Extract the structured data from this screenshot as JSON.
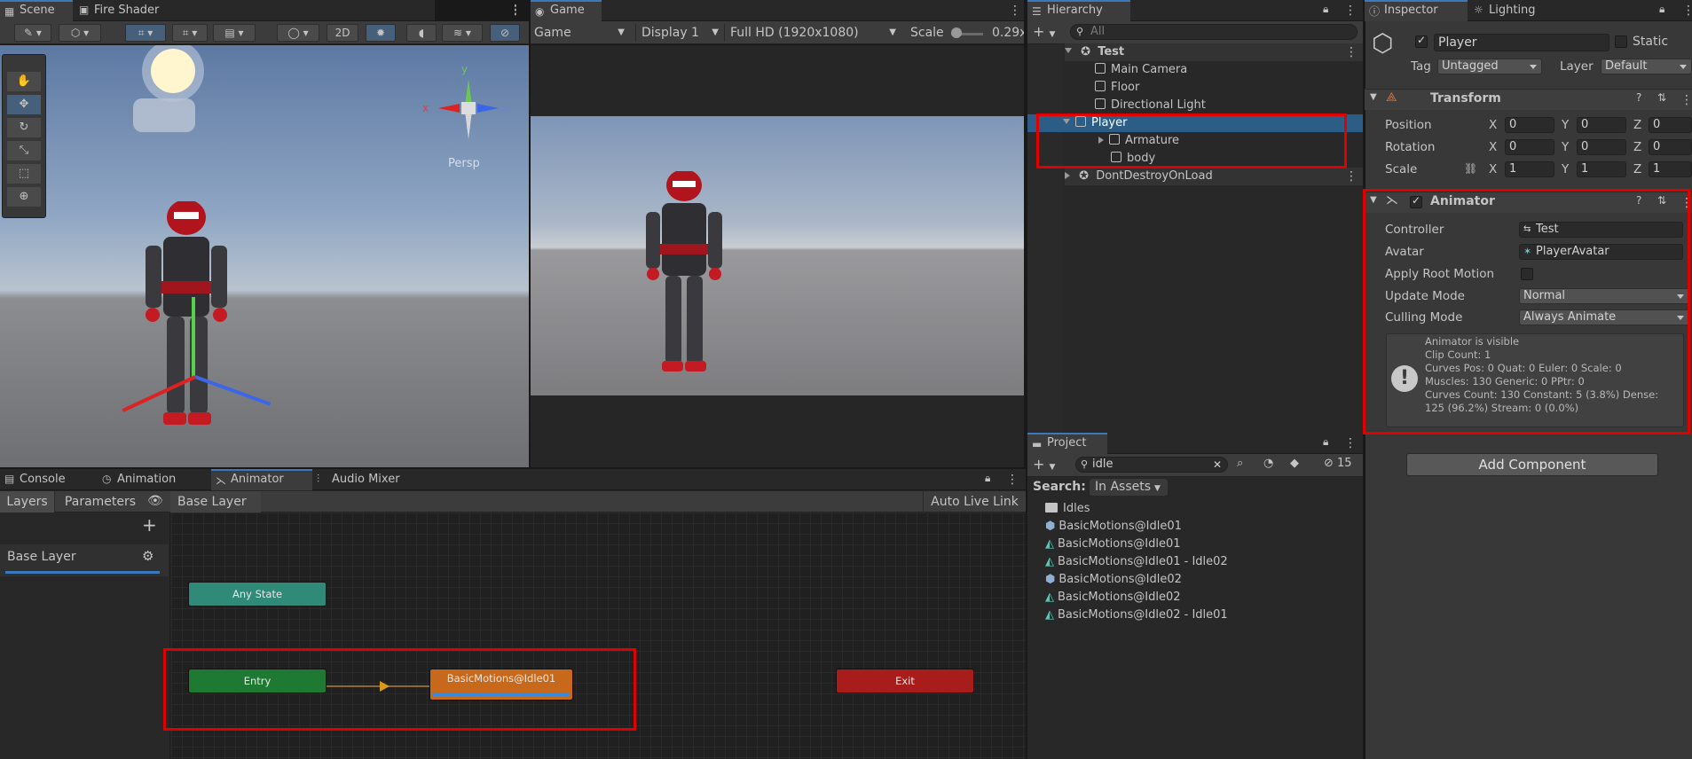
{
  "scene_tabs": {
    "scene": "Scene",
    "fire_shader": "Fire Shader"
  },
  "scene_toolbar": {
    "btn_2d": "2D",
    "persp": "Persp",
    "gizmo_x": "x",
    "gizmo_y": "y",
    "gizmo_z": "z"
  },
  "game": {
    "tab": "Game",
    "view_dropdown": "Game",
    "display_dropdown": "Display 1",
    "resolution_dropdown": "Full HD (1920x1080)",
    "scale_label": "Scale",
    "scale_value": "0.29x"
  },
  "hierarchy": {
    "tab": "Hierarchy",
    "search_placeholder": "All",
    "items": {
      "test": "Test",
      "main_camera": "Main Camera",
      "floor": "Floor",
      "directional_light": "Directional Light",
      "player": "Player",
      "armature": "Armature",
      "body": "body",
      "dont_destroy": "DontDestroyOnLoad"
    }
  },
  "inspector": {
    "tab": "Inspector",
    "lighting_tab": "Lighting",
    "object_name": "Player",
    "static_label": "Static",
    "tag_label": "Tag",
    "tag_value": "Untagged",
    "layer_label": "Layer",
    "layer_value": "Default",
    "transform": {
      "title": "Transform",
      "position_label": "Position",
      "rotation_label": "Rotation",
      "scale_label": "Scale",
      "x": "X",
      "y": "Y",
      "z": "Z",
      "position": [
        "0",
        "0",
        "0"
      ],
      "rotation": [
        "0",
        "0",
        "0"
      ],
      "scale": [
        "1",
        "1",
        "1"
      ]
    },
    "animator": {
      "title": "Animator",
      "controller_label": "Controller",
      "controller_value": "Test",
      "avatar_label": "Avatar",
      "avatar_value": "PlayerAvatar",
      "apply_root_motion_label": "Apply Root Motion",
      "update_mode_label": "Update Mode",
      "update_mode_value": "Normal",
      "culling_mode_label": "Culling Mode",
      "culling_mode_value": "Always Animate",
      "info": [
        "Animator is visible",
        "Clip Count: 1",
        "Curves Pos: 0 Quat: 0 Euler: 0 Scale: 0",
        "Muscles: 130 Generic: 0 PPtr: 0",
        "Curves Count: 130 Constant: 5 (3.8%) Dense:",
        "125 (96.2%) Stream: 0 (0.0%)"
      ]
    },
    "add_component": "Add Component"
  },
  "bottom_tabs": {
    "console": "Console",
    "animation": "Animation",
    "animator": "Animator",
    "audio_mixer": "Audio Mixer"
  },
  "animator_window": {
    "layers_tab": "Layers",
    "parameters_tab": "Parameters",
    "breadcrumb": "Base Layer",
    "auto_live_link": "Auto Live Link",
    "layer_name": "Base Layer",
    "nodes": {
      "any_state": "Any State",
      "entry": "Entry",
      "idle": "BasicMotions@Idle01",
      "exit": "Exit"
    }
  },
  "project": {
    "tab": "Project",
    "search_value": "idle",
    "hidden_count": "15",
    "search_label": "Search:",
    "search_scope": "In Assets",
    "items": [
      "Idles",
      "BasicMotions@Idle01",
      "BasicMotions@Idle01",
      "BasicMotions@Idle01 - Idle02",
      "BasicMotions@Idle02",
      "BasicMotions@Idle02",
      "BasicMotions@Idle02 - Idle01"
    ]
  },
  "colors": {
    "accent": "#3a79bb",
    "highlight_red": "#e00000",
    "entry_node": "#1e7a32",
    "state_node": "#c8681a",
    "exit_node": "#a81c1c",
    "any_state_node": "#2f8a78"
  }
}
